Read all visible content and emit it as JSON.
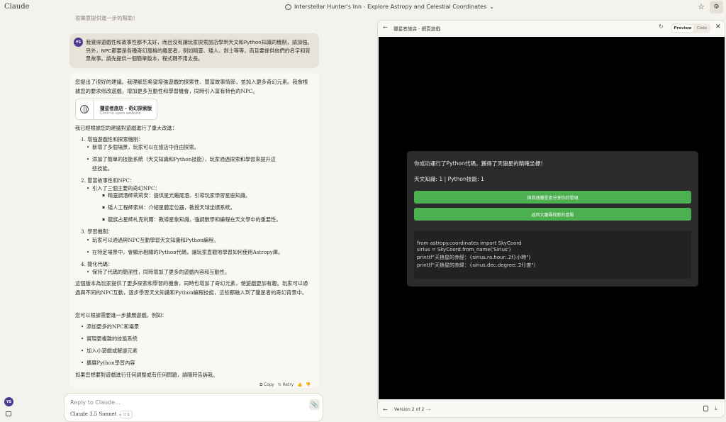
{
  "app": {
    "brand": "Claude"
  },
  "conversation": {
    "title": "Interstellar Hunter's Inn - Explore Astropy and Celestial Coordinates",
    "chevron": "⌄"
  },
  "topbar": {
    "star_icon": "☆",
    "settings_icon": "⚙"
  },
  "chat": {
    "faded_text": "很樂意提供進一步的幫助！",
    "user": {
      "initials": "YS",
      "message": "我覺得遊戲性和故事性都不太好，而且沒有讓玩家探索旅店學到天文和Python知識的機制，請加強。另外，NPC都要是各種奇幻風格的羅星者，例如精靈、矮人、劍士等等，而且要提供他們的名字和背景故事。請先提供一個簡單版本，程式碼不用太長。"
    },
    "assistant": {
      "intro": "您提出了很好的建議。我理解您希望增強遊戲的探索性、豐富故事情節，並加入更多奇幻元素。我會根據您的要求修改遊戲，增加更多互動性和學習機會，同時引入富有特色的NPC。",
      "artifact": {
        "title": "獵星者旅店 - 奇幻探索版",
        "subtitle": "Click to open website"
      },
      "changes_heading": "我已經根據您的建議對遊戲進行了重大改進：",
      "list": {
        "i1": "1. 增強遊戲性和探索機制：",
        "i1a": "新增了多個場景，玩家可以在旅店中自由探索。",
        "i1b": "添加了簡單的技能系統（天文知識和Python技能），玩家通過探索和學習來提升這",
        "i1b2": "些技能。",
        "i2": "2. 豐富故事性和NPC：",
        "i2a": "引入了三個主要的奇幻NPC：",
        "i2a1": "精靈調酒師莉莉安：提供星光雞尾酒，引導玩家學習星座知識。",
        "i2a2": "矮人工程師索林：介紹星體定位器，教授天球坐標系統。",
        "i2a3": "龍族占星師札克利爾：教導星象知識，強調數學和編程在天文學中的重要性。",
        "i3": "3. 學習機制：",
        "i3a": "玩家可以通過與NPC互動學習天文知識和Python編程。",
        "i3b": "在特定場景中，會顯示相關的Python代碼，讓玩家直觀地學習如何使用Astropy庫。",
        "i4": "4. 簡化代碼：",
        "i4a": "保持了代碼的簡潔性，同時增加了更多的遊戲內容和互動性。"
      },
      "summary": "這個版本為玩家提供了更多探索和學習的機會，同時也增加了奇幻元素，使遊戲更加有趣。玩家可以通過與不同的NPC互動，逐步學習天文知識和Python編程技能，這些都融入到了獵星者的奇幻背景中。",
      "expand_heading": "您可以根據需要進一步擴展遊戲，例如：",
      "expand": [
        "添加更多的NPC和場景",
        "實現更複雜的技能系統",
        "加入小遊戲或解謎元素",
        "擴展Python學習內容"
      ],
      "closing": "如果您想要對遊戲進行任何調整或有任何問題，請隨時告訴我。",
      "actions": {
        "copy": "Copy",
        "retry": "Retry"
      }
    }
  },
  "composer": {
    "placeholder": "Reply to Claude...",
    "model": "Claude 3.5 Sonnet",
    "model_chevron": "⌄",
    "count": "1",
    "attach_icon": "📎"
  },
  "sidebar": {
    "user_initials": "YS"
  },
  "preview": {
    "title": "獵星者旅店 - 網頁遊戲",
    "tab_preview": "Preview",
    "tab_code": "Code",
    "game": {
      "message": "你成功運行了Python代碼，獲得了天狼星的精確坐標！",
      "stats": "天文知識: 1 | Python技能: 1",
      "button1": "與其他獵星者分享你的發現",
      "button2": "返回大廳尋找新的冒險",
      "code": [
        "from astropy.coordinates import SkyCoord",
        "sirius = SkyCoord.from_name('Sirius')",
        "print(f\"天狼星的赤經：{sirius.ra.hour:.2f}小時\")",
        "print(f\"天狼星的赤緯：{sirius.dec.degree:.2f}度\")"
      ]
    },
    "version_label": "Version 2 of 2"
  }
}
